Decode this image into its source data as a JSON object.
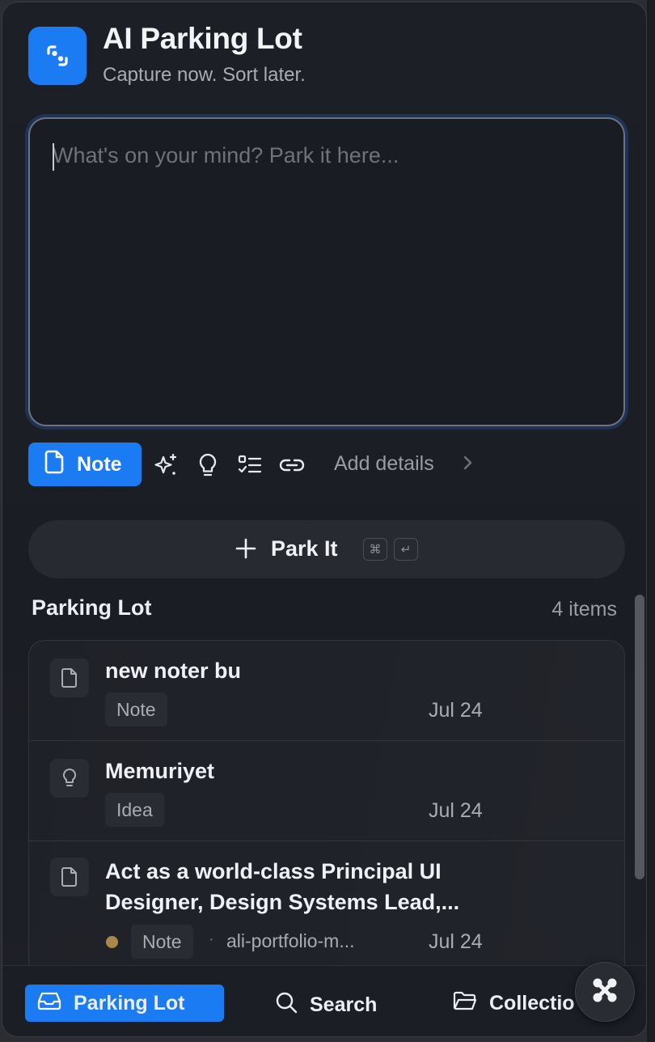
{
  "app": {
    "title": "AI Parking Lot",
    "subtitle": "Capture now. Sort later.",
    "accent_color": "#1a7bf2"
  },
  "composer": {
    "placeholder": "What's on your mind? Park it here...",
    "value": ""
  },
  "toolbar": {
    "active_type_label": "Note",
    "icons": [
      "note-icon",
      "sparkles-icon",
      "lightbulb-icon",
      "checklist-icon",
      "link-icon"
    ],
    "add_details_label": "Add details"
  },
  "park_button": {
    "label": "Park It",
    "shortcut_keys": [
      "⌘",
      "↵"
    ]
  },
  "list": {
    "title": "Parking Lot",
    "count_label": "4 items",
    "items": [
      {
        "icon": "note-icon",
        "title": "new noter bu",
        "type": "Note",
        "date": "Jul 24"
      },
      {
        "icon": "lightbulb-icon",
        "title": "Memuriyet",
        "type": "Idea",
        "date": "Jul 24"
      },
      {
        "icon": "note-icon",
        "title_line1": "Act as a world-class Principal UI",
        "title_line2": "Designer, Design Systems Lead,...",
        "type": "Note",
        "source": "ali-portfolio-m...",
        "source_sep": "·",
        "date": "Jul 24"
      }
    ]
  },
  "bottom_nav": {
    "items": [
      {
        "label": "Parking Lot",
        "icon": "inbox-icon",
        "active": true
      },
      {
        "label": "Search",
        "icon": "search-icon",
        "active": false
      },
      {
        "label": "Collectio",
        "icon": "folder-icon",
        "active": false
      }
    ]
  }
}
